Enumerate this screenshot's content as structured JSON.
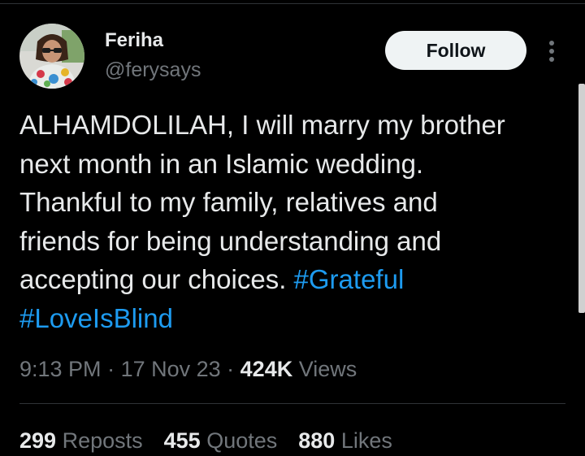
{
  "user": {
    "name": "Feriha",
    "handle": "@ferysays"
  },
  "follow_label": "Follow",
  "tweet": {
    "text": "ALHAMDOLILAH, I will marry my brother\nnext month in an Islamic wedding.\nThankful to my family, relatives and\nfriends for being understanding and\naccepting our choices. ",
    "hashtag_1": "#Grateful",
    "hashtag_2": "#LoveIsBlind"
  },
  "meta": {
    "time": "9:13 PM",
    "separator": " · ",
    "date": "17 Nov 23",
    "views_count": "424K",
    "views_label": " Views"
  },
  "stats": {
    "reposts_count": "299",
    "reposts_label": " Reposts",
    "quotes_count": "455",
    "quotes_label": " Quotes",
    "likes_count": "880",
    "likes_label": " Likes"
  },
  "icons": {
    "more": "more-vertical-icon",
    "avatar": "profile-photo"
  },
  "colors": {
    "background": "#000000",
    "text_primary": "#e7e9ea",
    "text_secondary": "#71767b",
    "link": "#1d9bf0",
    "follow_bg": "#eff3f4",
    "divider": "#2f3336"
  }
}
